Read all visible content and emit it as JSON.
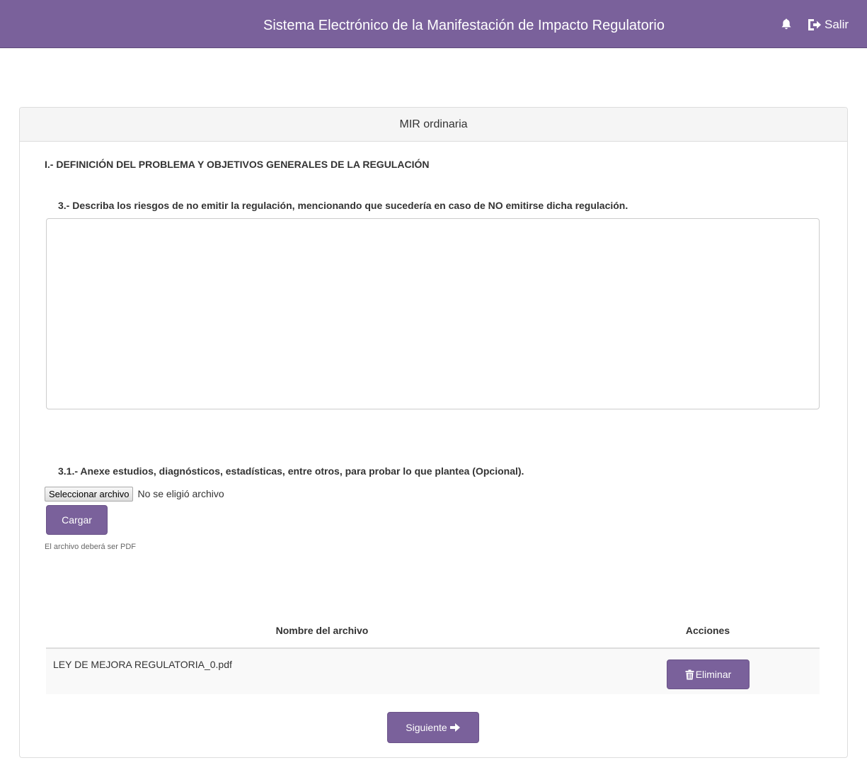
{
  "header": {
    "title": "Sistema Electrónico de la Manifestación de Impacto Regulatorio",
    "logout_label": "Salir",
    "icons": [
      "bell-icon",
      "logout-icon"
    ]
  },
  "panel": {
    "heading": "MIR ordinaria",
    "section_title": "I.- DEFINICIÓN DEL PROBLEMA Y OBJETIVOS GENERALES DE LA REGULACIÓN",
    "question_3": "3.- Describa los riesgos de no emitir la regulación, mencionando que sucedería en caso de NO emitirse dicha regulación.",
    "answer_3_value": "",
    "question_3_1": "3.1.- Anexe estudios, diagnósticos, estadísticas, entre otros, para probar lo que plantea (Opcional).",
    "file_input": {
      "button_label": "Seleccionar archivo",
      "status": "No se eligió archivo"
    },
    "upload_label": "Cargar",
    "help_text": "El archivo deberá ser PDF",
    "table": {
      "headers": [
        "Nombre del archivo",
        "Acciones"
      ],
      "rows": [
        {
          "filename": "LEY DE MEJORA REGULATORIA_0.pdf",
          "action_label": "Eliminar"
        }
      ]
    },
    "next_label": "Siguiente"
  },
  "colors": {
    "brand": "#7a619b",
    "panel_heading_bg": "#f5f5f5",
    "row_bg": "#f9f9f9"
  }
}
